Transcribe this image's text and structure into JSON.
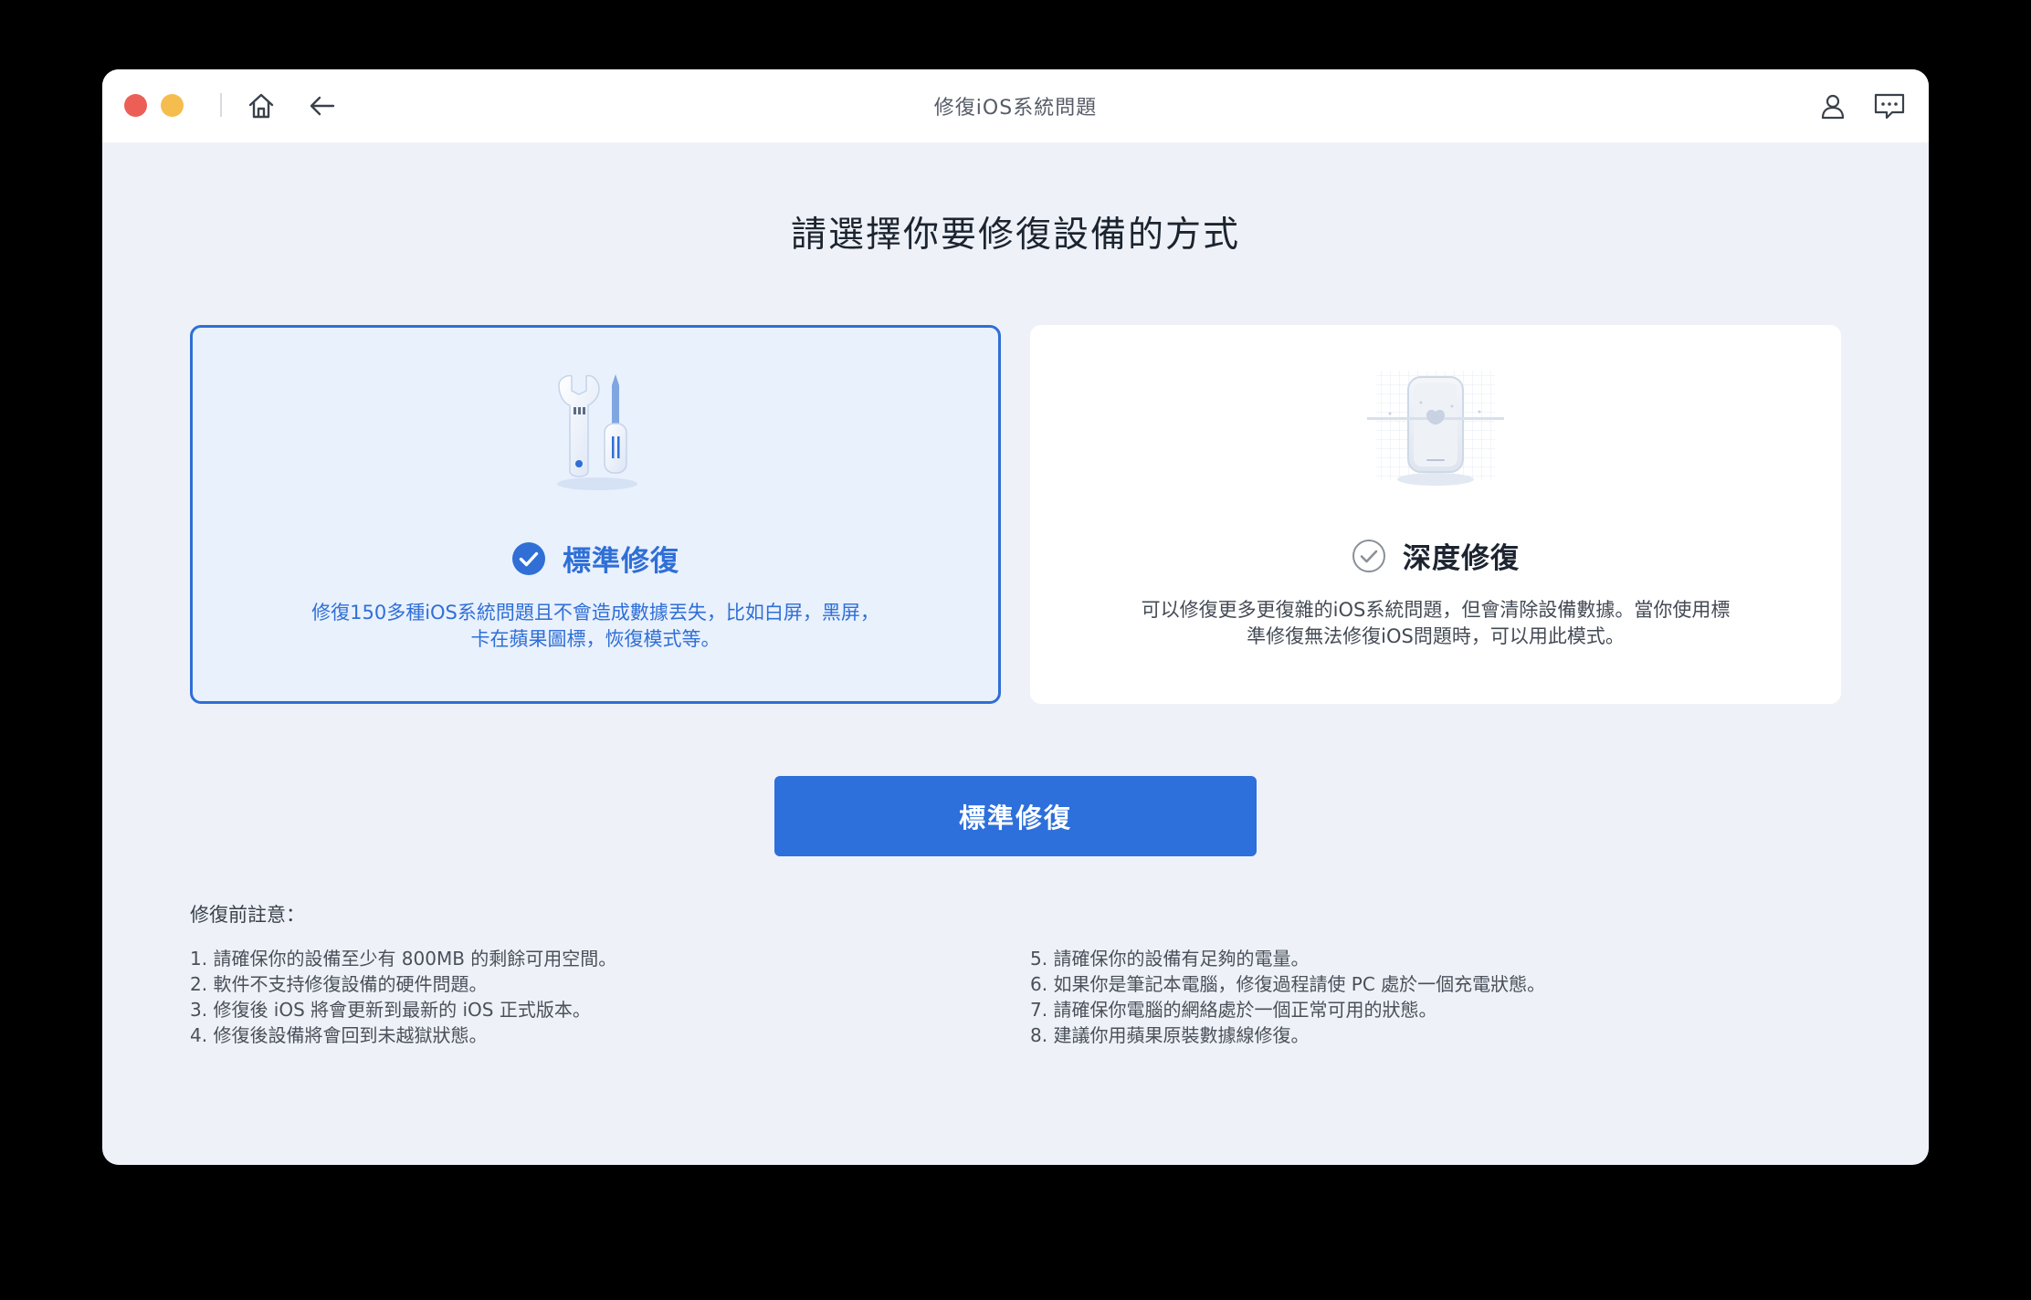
{
  "window": {
    "title": "修復iOS系統問題"
  },
  "page": {
    "heading": "請選擇你要修復設備的方式"
  },
  "modes": {
    "standard": {
      "name": "標準修復",
      "description": "修復150多種iOS系統問題且不會造成數據丟失，比如白屏，黑屏，卡在蘋果圖標，恢復模式等。",
      "selected": true,
      "icon": "wrench-screwdriver-icon"
    },
    "deep": {
      "name": "深度修復",
      "description": "可以修復更多更復雜的iOS系統問題，但會清除設備數據。當你使用標準修復無法修復iOS問題時，可以用此模式。",
      "selected": false,
      "icon": "phone-scan-icon"
    }
  },
  "action": {
    "primary_label": "標準修復"
  },
  "notes": {
    "title": "修復前註意：",
    "left": [
      "1. 請確保你的設備至少有 800MB 的剩餘可用空間。",
      "2. 軟件不支持修復設備的硬件問題。",
      "3. 修復後 iOS 將會更新到最新的 iOS 正式版本。",
      "4. 修復後設備將會回到未越獄狀態。"
    ],
    "right": [
      "5. 請確保你的設備有足夠的電量。",
      "6. 如果你是筆記本電腦，修復過程請使 PC 處於一個充電狀態。",
      "7. 請確保你電腦的網絡處於一個正常可用的狀態。",
      "8. 建議你用蘋果原裝數據線修復。"
    ]
  },
  "colors": {
    "accent": "#2d6fdb",
    "background": "#eef2f8",
    "selected_card": "#e9f1fd",
    "close": "#ec5f57",
    "minimize": "#f4bd4e"
  }
}
